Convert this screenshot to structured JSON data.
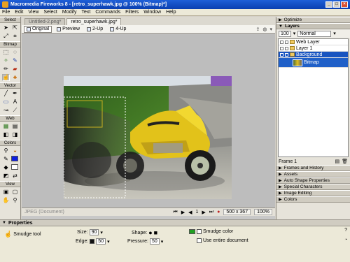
{
  "window": {
    "title": "Macromedia Fireworks 8 - [retro_superhawk.jpg @ 100% (Bitmap)*]"
  },
  "menu": [
    "File",
    "Edit",
    "View",
    "Select",
    "Modify",
    "Text",
    "Commands",
    "Filters",
    "Window",
    "Help"
  ],
  "tools": {
    "select": "Select",
    "bitmap": "Bitmap",
    "vector": "Vector",
    "web": "Web",
    "colors": "Colors",
    "view": "View"
  },
  "doc": {
    "tabs": [
      "Untitled-2.png*",
      "retro_superhawk.jpg*"
    ],
    "views": [
      "Original",
      "Preview",
      "2-Up",
      "4-Up"
    ]
  },
  "status": {
    "format": "JPEG (Document)",
    "frame": "1",
    "size": "500 x 367",
    "zoom": "100%"
  },
  "panels": {
    "optimize": "Optimize",
    "layers": "Layers",
    "opacity": "100",
    "blend": "Normal",
    "layer_rows": [
      "Web Layer",
      "Layer 1",
      "Background",
      "Bitmap"
    ],
    "frame": "Frame 1",
    "collapsed": [
      "Frames and History",
      "Assets",
      "Auto Shape Properties",
      "Special Characters",
      "Image Editing",
      "Colors"
    ]
  },
  "props": {
    "title": "Properties",
    "tool": "Smudge tool",
    "size_label": "Size:",
    "size_value": "90",
    "edge_label": "Edge:",
    "edge_value": "50",
    "shape_label": "Shape:",
    "pressure_label": "Pressure:",
    "pressure_value": "50",
    "smudge_color": "Smudge color",
    "entire_doc": "Use entire document"
  },
  "colors": {
    "title_bar": "#1e5fd8",
    "accent_green": "#20a020",
    "selection": "#1854c0"
  }
}
